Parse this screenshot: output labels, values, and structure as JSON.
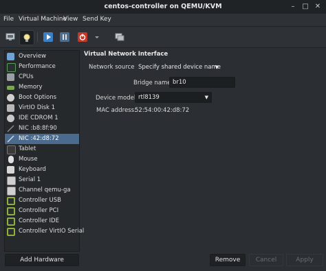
{
  "window": {
    "title": "centos-controller on QEMU/KVM"
  },
  "menu": [
    "File",
    "Virtual Machine",
    "View",
    "Send Key"
  ],
  "toolbar": {
    "icons": [
      "monitor-icon",
      "lightbulb-icon",
      "play-icon",
      "pause-icon",
      "power-icon",
      "chevron-down-icon",
      "screenshot-icon"
    ]
  },
  "sidebar": {
    "items": [
      {
        "label": "Overview",
        "icon": "overview-icon",
        "color": "#6fa3d6"
      },
      {
        "label": "Performance",
        "icon": "performance-icon",
        "color": "#5aa05a"
      },
      {
        "label": "CPUs",
        "icon": "cpu-icon",
        "color": "#9aa0a6"
      },
      {
        "label": "Memory",
        "icon": "memory-icon",
        "color": "#7aa650"
      },
      {
        "label": "Boot Options",
        "icon": "boot-icon",
        "color": "#d0d0d0"
      },
      {
        "label": "VirtIO Disk 1",
        "icon": "disk-icon",
        "color": "#b8b8b8"
      },
      {
        "label": "IDE CDROM 1",
        "icon": "cdrom-icon",
        "color": "#c8c8c8"
      },
      {
        "label": "NIC :b8:8f:90",
        "icon": "nic-icon",
        "color": "#8c8c8c"
      },
      {
        "label": "NIC :42:d8:72",
        "icon": "nic-icon",
        "color": "#8c8c8c"
      },
      {
        "label": "Tablet",
        "icon": "tablet-icon",
        "color": "#3a3a3a"
      },
      {
        "label": "Mouse",
        "icon": "mouse-icon",
        "color": "#e0e0e0"
      },
      {
        "label": "Keyboard",
        "icon": "keyboard-icon",
        "color": "#d8d8d8"
      },
      {
        "label": "Serial 1",
        "icon": "serial-icon",
        "color": "#d0d0d0"
      },
      {
        "label": "Channel qemu-ga",
        "icon": "channel-icon",
        "color": "#d0d0d0"
      },
      {
        "label": "Controller USB",
        "icon": "controller-icon",
        "color": "#8fb03c"
      },
      {
        "label": "Controller PCI",
        "icon": "controller-icon",
        "color": "#8fb03c"
      },
      {
        "label": "Controller IDE",
        "icon": "controller-icon",
        "color": "#8fb03c"
      },
      {
        "label": "Controller VirtIO Serial",
        "icon": "controller-icon",
        "color": "#8fb03c"
      }
    ],
    "selected_index": 8,
    "add_hardware_label": "Add Hardware"
  },
  "details": {
    "heading": "Virtual Network Interface",
    "network_source_label": "Network source:",
    "network_source_value": "Specify shared device name",
    "bridge_name_label": "Bridge name:",
    "bridge_name_value": "br10",
    "device_model_label": "Device model:",
    "device_model_value": "rtl8139",
    "mac_label": "MAC address:",
    "mac_value": "52:54:00:42:d8:72"
  },
  "buttons": {
    "remove": "Remove",
    "cancel": "Cancel",
    "apply": "Apply"
  },
  "colors": {
    "selection": "#4a6a8e",
    "background": "#2b2f33",
    "play": "#3b7fc4",
    "power": "#c0392b"
  }
}
